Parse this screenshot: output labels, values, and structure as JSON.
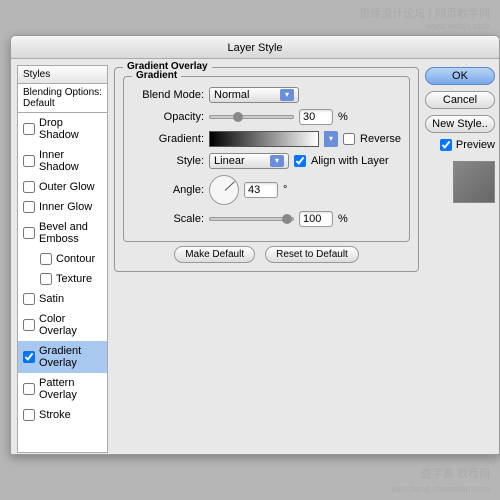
{
  "watermarks": {
    "top1": "思缘设计论坛",
    "top2": "网页教学网",
    "top_url": "www.webjx.com",
    "bottom1": "查字典 教程网",
    "bottom2": "jiaocheng.chazidian.com"
  },
  "window": {
    "title": "Layer Style"
  },
  "sidebar": {
    "header": "Styles",
    "blending": "Blending Options: Default",
    "items": [
      {
        "label": "Drop Shadow",
        "checked": false
      },
      {
        "label": "Inner Shadow",
        "checked": false
      },
      {
        "label": "Outer Glow",
        "checked": false
      },
      {
        "label": "Inner Glow",
        "checked": false
      },
      {
        "label": "Bevel and Emboss",
        "checked": false
      },
      {
        "label": "Contour",
        "checked": false,
        "indent": true
      },
      {
        "label": "Texture",
        "checked": false,
        "indent": true
      },
      {
        "label": "Satin",
        "checked": false
      },
      {
        "label": "Color Overlay",
        "checked": false
      },
      {
        "label": "Gradient Overlay",
        "checked": true,
        "selected": true
      },
      {
        "label": "Pattern Overlay",
        "checked": false
      },
      {
        "label": "Stroke",
        "checked": false
      }
    ]
  },
  "panel": {
    "group_title": "Gradient Overlay",
    "subgroup_title": "Gradient",
    "blend_mode_label": "Blend Mode:",
    "blend_mode_value": "Normal",
    "opacity_label": "Opacity:",
    "opacity_value": "30",
    "opacity_suffix": "%",
    "gradient_label": "Gradient:",
    "reverse_label": "Reverse",
    "style_label": "Style:",
    "style_value": "Linear",
    "align_label": "Align with Layer",
    "angle_label": "Angle:",
    "angle_value": "43",
    "angle_suffix": "°",
    "scale_label": "Scale:",
    "scale_value": "100",
    "scale_suffix": "%",
    "make_default": "Make Default",
    "reset_default": "Reset to Default"
  },
  "buttons": {
    "ok": "OK",
    "cancel": "Cancel",
    "new_style": "New Style..",
    "preview": "Preview"
  }
}
